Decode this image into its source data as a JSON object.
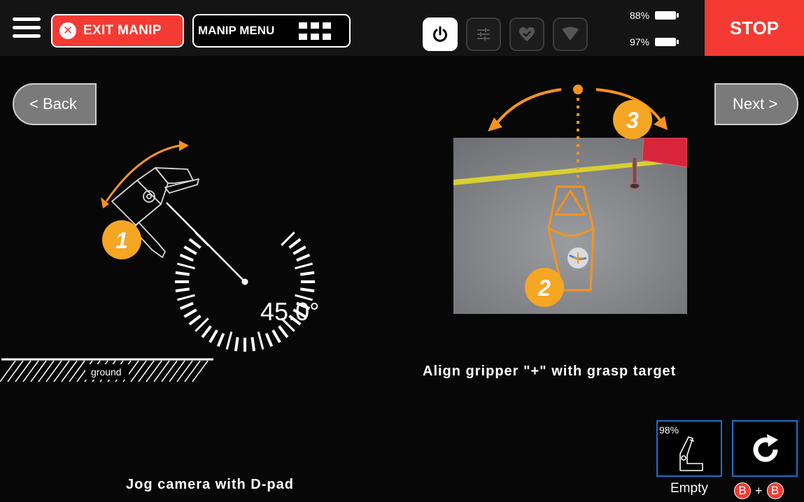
{
  "topbar": {
    "exit_label": "EXIT MANIP",
    "manip_menu_label": "MANIP MENU",
    "battery_1": "88%",
    "battery_2": "97%",
    "stop_label": "STOP"
  },
  "nav": {
    "back_label": "< Back",
    "next_label": "Next >"
  },
  "left_panel": {
    "angle": "45.0°",
    "ground_label": "ground",
    "step_badge": "1",
    "instruction": "Jog camera with D-pad"
  },
  "right_panel": {
    "step_badge_2": "2",
    "step_badge_3": "3",
    "instruction": "Align gripper \"+\" with grasp target"
  },
  "bottom": {
    "gripper_pct": "98%",
    "gripper_label": "Empty",
    "combo_key": "B",
    "combo_plus": "+"
  },
  "colors": {
    "accent_orange": "#f7931e",
    "badge_yellow": "#f5a623",
    "stop_red": "#f43a32",
    "slot_blue": "#1e6fc8"
  },
  "icons": [
    "menu-icon",
    "exit-x-icon",
    "grid-icon",
    "power-icon",
    "sliders-icon",
    "heart-icon",
    "wifi-icon",
    "battery-icon",
    "gripper-icon",
    "refresh-icon"
  ]
}
